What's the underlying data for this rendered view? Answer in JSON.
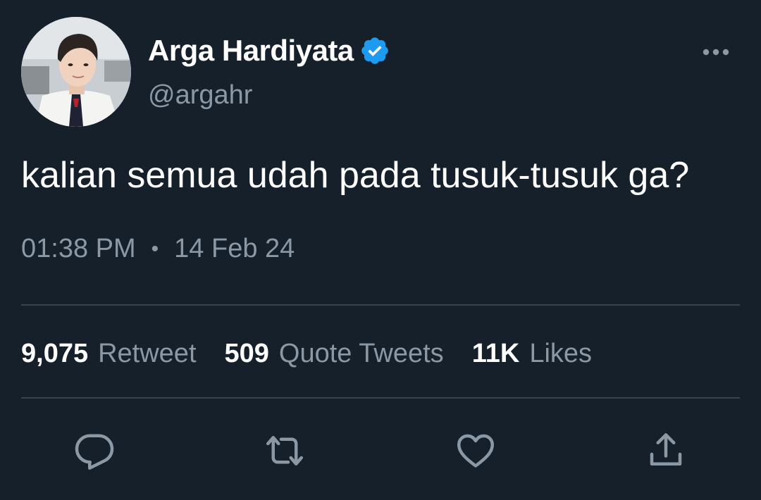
{
  "author": {
    "display_name": "Arga Hardiyata",
    "handle": "@argahr",
    "verified": true,
    "avatar_icon": "profile-photo"
  },
  "tweet": {
    "text": "kalian semua udah pada tusuk-tusuk ga?",
    "time": "01:38 PM",
    "separator": "•",
    "date": "14 Feb 24"
  },
  "stats": [
    {
      "count": "9,075",
      "label": "Retweet"
    },
    {
      "count": "509",
      "label": "Quote Tweets"
    },
    {
      "count": "11K",
      "label": "Likes"
    }
  ],
  "actions": {
    "reply_icon": "reply-icon",
    "retweet_icon": "retweet-icon",
    "like_icon": "heart-icon",
    "share_icon": "share-icon"
  },
  "colors": {
    "background": "#15202b",
    "text": "#ffffff",
    "secondary_text": "#8b98a5",
    "divider": "#38444d",
    "verified_badge": "#1d9bf0"
  }
}
